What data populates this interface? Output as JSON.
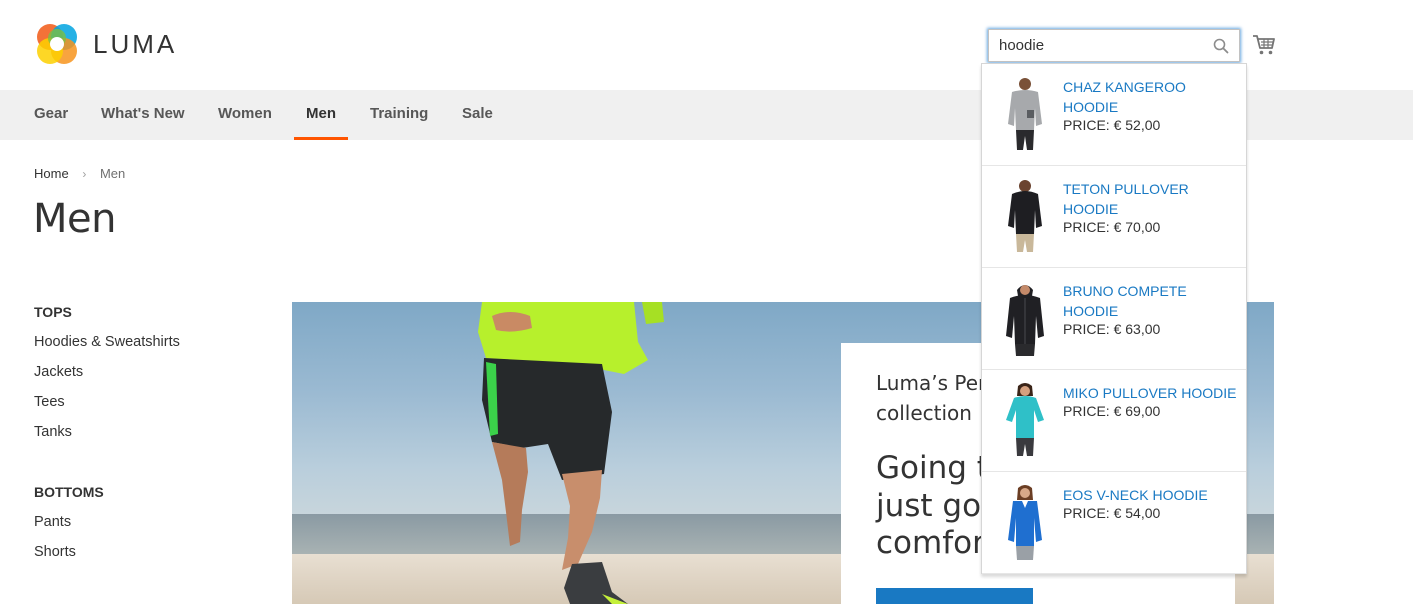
{
  "brand": {
    "name": "LUMA"
  },
  "search": {
    "value": "hoodie"
  },
  "nav": {
    "items": [
      {
        "label": "Gear"
      },
      {
        "label": "What's New"
      },
      {
        "label": "Women"
      },
      {
        "label": "Men",
        "active": true
      },
      {
        "label": "Training"
      },
      {
        "label": "Sale"
      }
    ]
  },
  "breadcrumb": {
    "home": "Home",
    "separator": "›",
    "current": "Men"
  },
  "page": {
    "title": "Men"
  },
  "sidebar": {
    "groups": [
      {
        "heading": "TOPS",
        "links": [
          "Hoodies & Sweatshirts",
          "Jackets",
          "Tees",
          "Tanks"
        ]
      },
      {
        "heading": "BOTTOMS",
        "links": [
          "Pants",
          "Shorts"
        ]
      }
    ]
  },
  "promo": {
    "line1": "Luma’s Per",
    "line2": "collection",
    "line3": "Going t",
    "line4": "just got",
    "line5": "comfor"
  },
  "autocomplete": {
    "items": [
      {
        "name": "CHAZ KANGEROO HOODIE",
        "price": "PRICE: € 52,00",
        "garment": "#a7a9ac",
        "trim": "#5a5d61"
      },
      {
        "name": "TETON PULLOVER HOODIE",
        "price": "PRICE: € 70,00",
        "garment": "#1e1e22",
        "trim": "#1e1e22"
      },
      {
        "name": "BRUNO COMPETE HOODIE",
        "price": "PRICE: € 63,00",
        "garment": "#202024",
        "trim": "#202024"
      },
      {
        "name": "MIKO PULLOVER HOODIE",
        "price": "PRICE: € 69,00",
        "garment": "#2fc0c8",
        "trim": "#2fc0c8"
      },
      {
        "name": "EOS V-NECK HOODIE",
        "price": "PRICE: € 54,00",
        "garment": "#1f6fd0",
        "trim": "#1f6fd0"
      }
    ]
  },
  "colors": {
    "link": "#1979c3",
    "accent": "#ff5501",
    "nav_bg": "#f0f0f0",
    "button": "#1979c3"
  }
}
